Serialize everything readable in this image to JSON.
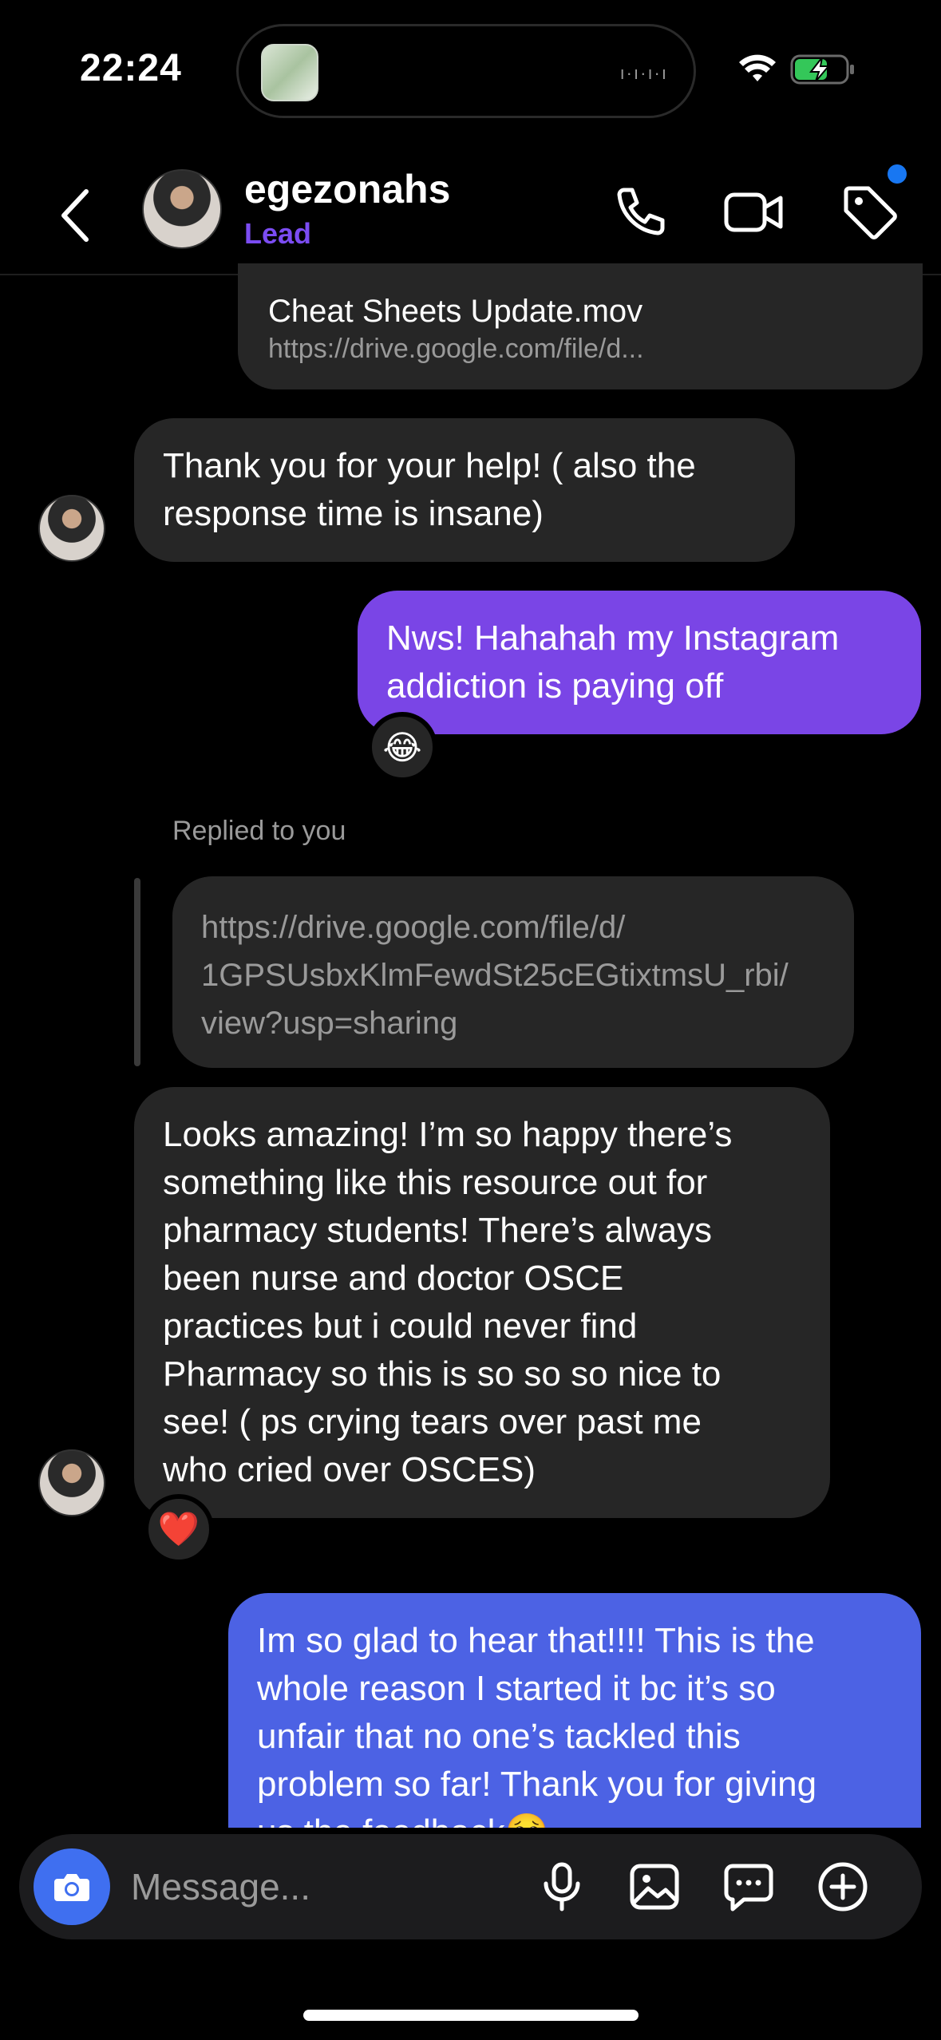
{
  "status": {
    "time": "22:24"
  },
  "header": {
    "username": "egezonahs",
    "tag": "Lead"
  },
  "file": {
    "title": "Cheat Sheets Update.mov",
    "url": "https://drive.google.com/file/d..."
  },
  "messages": {
    "m1": {
      "lines": [
        "Thank you for your help! ( also the",
        "response time is insane)"
      ]
    },
    "m2": {
      "lines": [
        "Nws! Hahahah my Instagram",
        "addiction is paying off"
      ],
      "reaction": "😂"
    },
    "reply": {
      "label": "Replied to you",
      "quote_lines": [
        "https://drive.google.com/file/d/",
        "1GPSUsbxKlmFewdSt25cEGtixtmsU_rbi/",
        "view?usp=sharing"
      ]
    },
    "m3": {
      "lines": [
        "Looks amazing! I’m so happy there’s",
        "something like this resource out for",
        "pharmacy students! There’s always",
        "been nurse and doctor OSCE",
        "practices but i could never find",
        "Pharmacy so this is so so so nice to",
        "see! ( ps crying tears over past me",
        "who cried over OSCES)"
      ],
      "reaction": "❤️"
    },
    "m4": {
      "lines": [
        "Im so glad to hear that!!!! This is the",
        "whole reason I started it bc it’s so",
        "unfair that no one’s tackled this",
        "problem so far! Thank you for giving",
        "us the feedback🥹"
      ]
    }
  },
  "composer": {
    "placeholder": "Message..."
  },
  "colors": {
    "accent_purple": "#7a45e6",
    "accent_blue": "#4c62e4",
    "lead_tag": "#7b4cf2",
    "camera_button": "#3f6ff0"
  },
  "icons": {
    "back": "chevron-left-icon",
    "call": "phone-icon",
    "video": "video-camera-icon",
    "tag": "tag-icon",
    "camera": "camera-icon",
    "mic": "microphone-icon",
    "gallery": "image-icon",
    "sticker": "chat-bubble-icon",
    "plus": "plus-circle-icon"
  }
}
